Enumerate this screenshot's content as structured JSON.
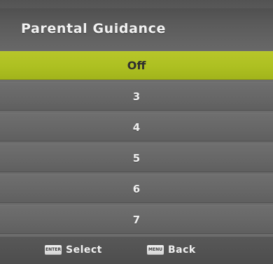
{
  "header": {
    "title": "Parental Guidance"
  },
  "menu": {
    "items": [
      {
        "label": "Off",
        "selected": true
      },
      {
        "label": "3",
        "selected": false
      },
      {
        "label": "4",
        "selected": false
      },
      {
        "label": "5",
        "selected": false
      },
      {
        "label": "6",
        "selected": false
      },
      {
        "label": "7",
        "selected": false
      }
    ]
  },
  "footer": {
    "enter_key": "ENTER",
    "select_label": "Select",
    "menu_key": "MENU",
    "back_label": "Back"
  },
  "colors": {
    "highlight": "#adc021",
    "row": "#666666",
    "header": "#555555",
    "footer": "#505050",
    "text_light": "#efefef",
    "text_dark": "#2f2f2f"
  }
}
